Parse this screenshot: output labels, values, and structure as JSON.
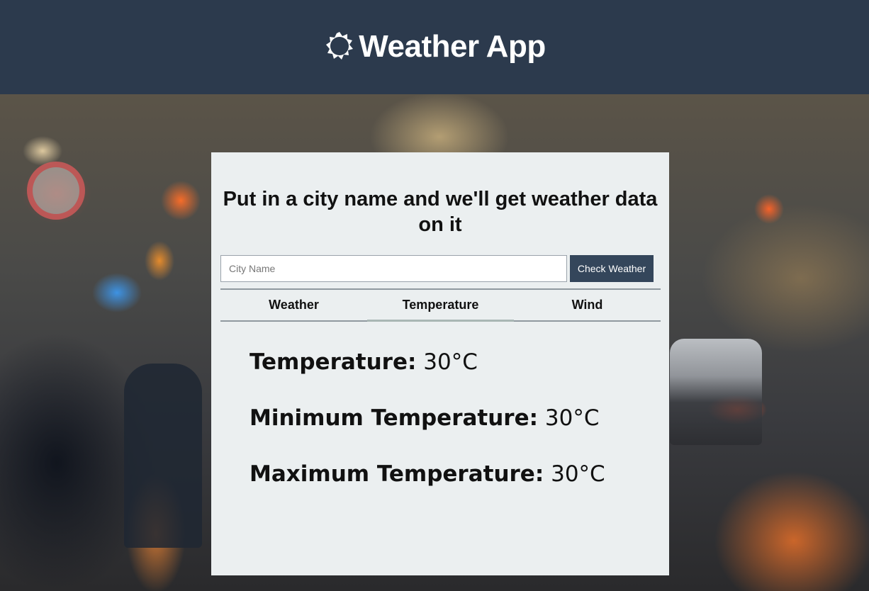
{
  "header": {
    "title": "Weather App",
    "icon": "sun-icon",
    "background": "#2c3a4d"
  },
  "card": {
    "heading": "Put in a city name and we'll get weather data on it",
    "search": {
      "placeholder": "City Name",
      "value": "",
      "button_label": "Check Weather"
    },
    "tabs": [
      {
        "label": "Weather",
        "active": false
      },
      {
        "label": "Temperature",
        "active": true
      },
      {
        "label": "Wind",
        "active": false
      }
    ],
    "stats": [
      {
        "label": "Temperature:",
        "value": "30°C"
      },
      {
        "label": "Minimum Temperature:",
        "value": "30°C"
      },
      {
        "label": "Maximum Temperature:",
        "value": "30°C"
      }
    ]
  },
  "colors": {
    "header_bg": "#2c3a4d",
    "button_bg": "#34465b",
    "card_bg": "#ebeff0"
  }
}
